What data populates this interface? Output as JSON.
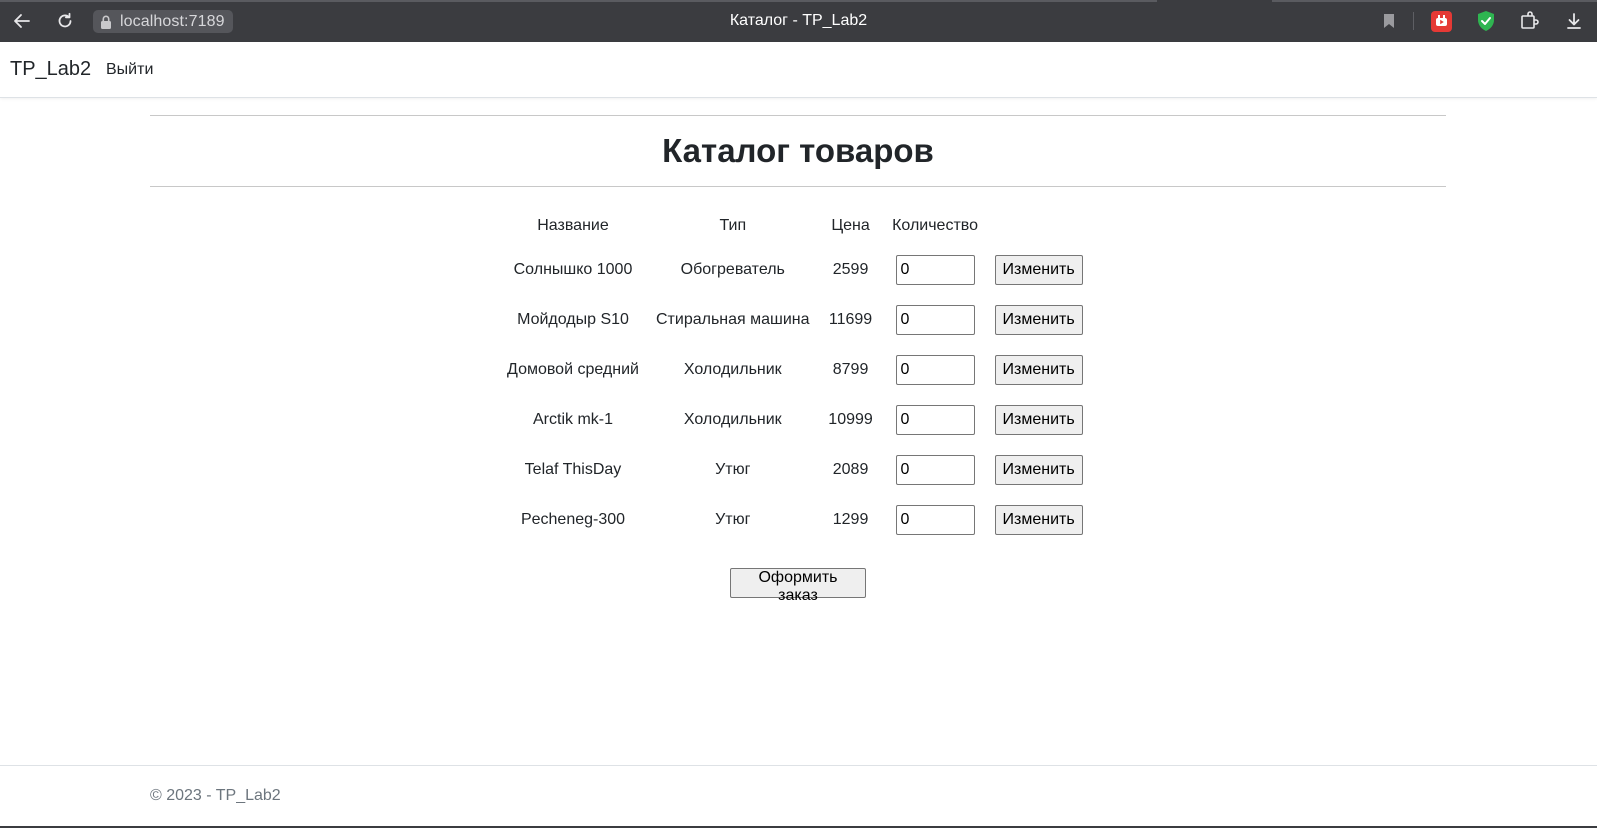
{
  "browser": {
    "url": "localhost:7189",
    "window_title": "Каталог - TP_Lab2"
  },
  "navbar": {
    "brand": "TP_Lab2",
    "logout_label": "Выйти"
  },
  "main": {
    "title": "Каталог товаров",
    "columns": [
      "Название",
      "Тип",
      "Цена",
      "Количество"
    ],
    "rows": [
      {
        "name": "Солнышко 1000",
        "type": "Обогреватель",
        "price": "2599",
        "qty": "0",
        "action": "Изменить"
      },
      {
        "name": "Мойдодыр S10",
        "type": "Стиральная машина",
        "price": "11699",
        "qty": "0",
        "action": "Изменить"
      },
      {
        "name": "Домовой средний",
        "type": "Холодильник",
        "price": "8799",
        "qty": "0",
        "action": "Изменить"
      },
      {
        "name": "Arctik mk-1",
        "type": "Холодильник",
        "price": "10999",
        "qty": "0",
        "action": "Изменить"
      },
      {
        "name": "Telaf ThisDay",
        "type": "Утюг",
        "price": "2089",
        "qty": "0",
        "action": "Изменить"
      },
      {
        "name": "Pecheneg-300",
        "type": "Утюг",
        "price": "1299",
        "qty": "0",
        "action": "Изменить"
      }
    ],
    "order_button": "Оформить заказ"
  },
  "footer": {
    "text": "© 2023 - TP_Lab2"
  },
  "icons": {
    "back": "arrow-left-icon",
    "reload": "reload-icon",
    "lock": "lock-icon",
    "bookmark": "bookmark-icon",
    "youtube": "youtube-extension-icon",
    "shield": "shield-check-extension-icon",
    "extensions": "puzzle-icon",
    "download": "download-icon"
  },
  "colors": {
    "chrome_bg": "#3b3c40",
    "youtube_red": "#e53935",
    "shield_green": "#2fb551"
  }
}
